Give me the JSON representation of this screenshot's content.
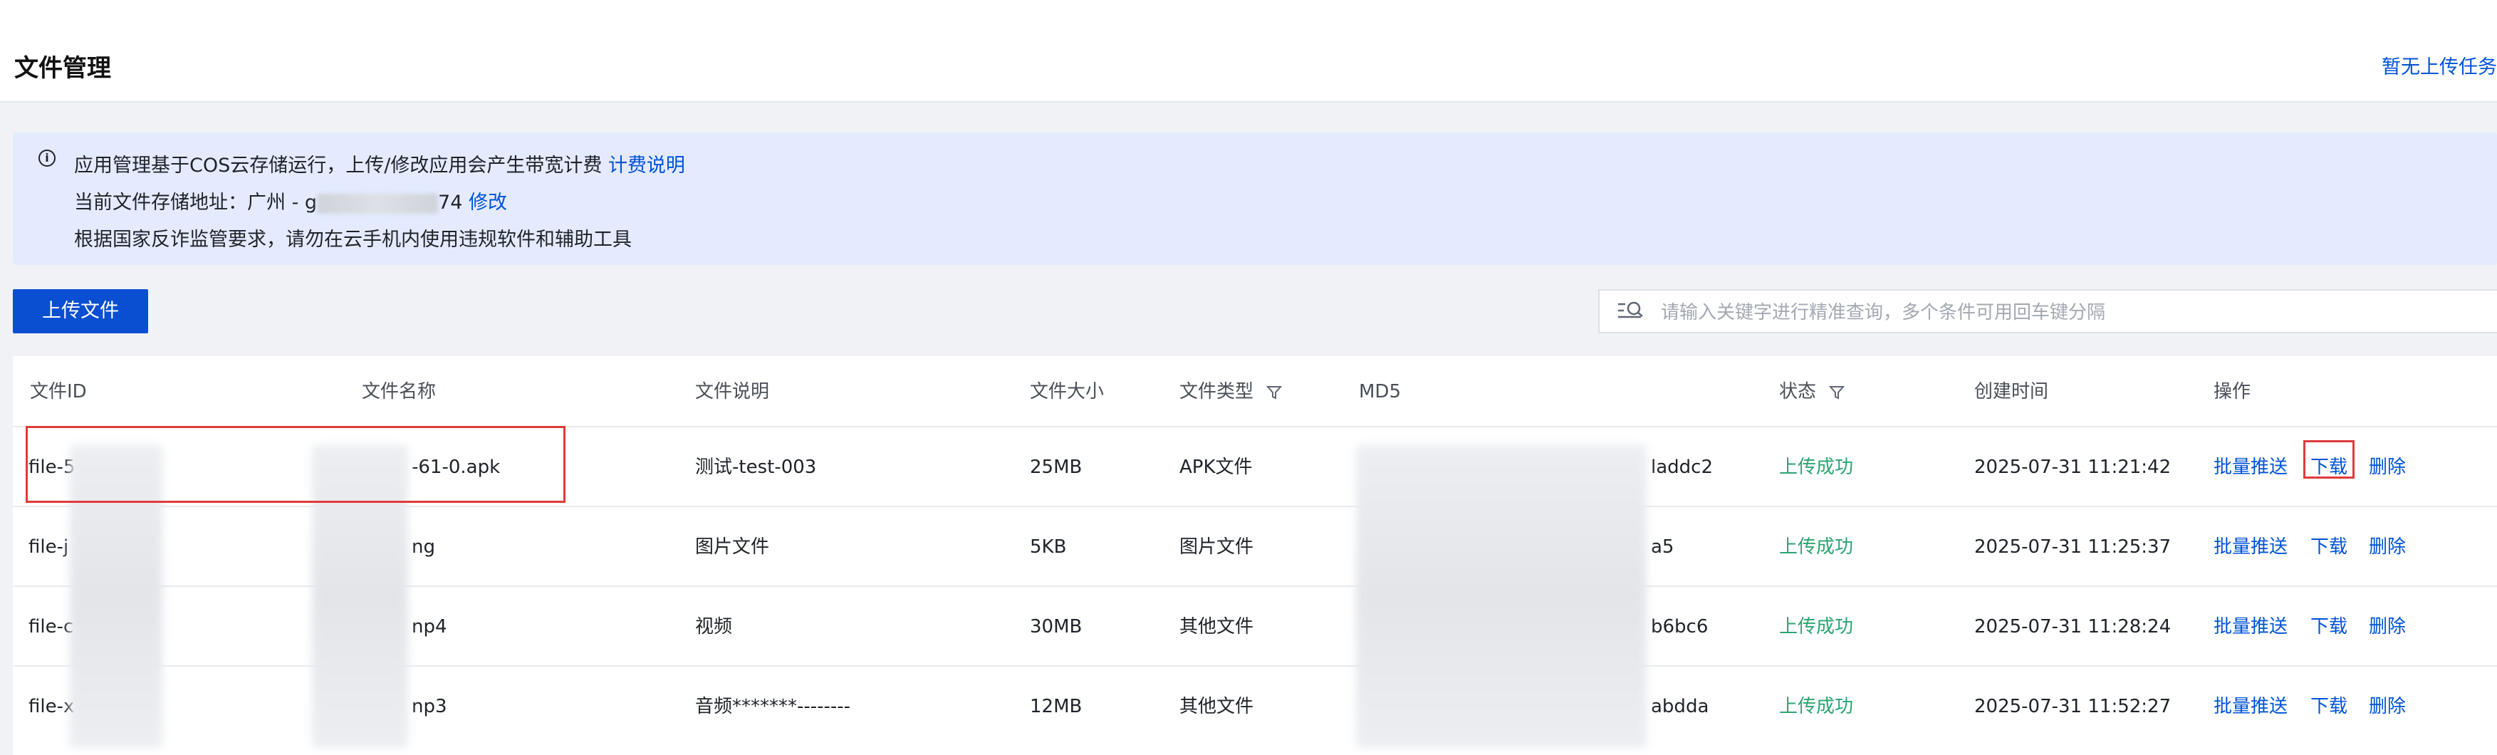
{
  "header": {
    "title": "文件管理",
    "upload_tasks_link": "暂无上传任务"
  },
  "notice": {
    "line1_text": "应用管理基于COS云存储运行，上传/修改应用会产生带宽计费",
    "line1_link": "计费说明",
    "line2_prefix": "当前文件存储地址：广州 - g",
    "line2_suffix": "74",
    "line2_link": "修改",
    "line3_text": "根据国家反诈监管要求，请勿在云手机内使用违规软件和辅助工具"
  },
  "toolbar": {
    "upload_button": "上传文件",
    "search_placeholder": "请输入关键字进行精准查询，多个条件可用回车键分隔"
  },
  "table": {
    "headers": {
      "file_id": "文件ID",
      "file_name": "文件名称",
      "description": "文件说明",
      "size": "文件大小",
      "type": "文件类型",
      "md5": "MD5",
      "status": "状态",
      "created": "创建时间",
      "actions": "操作"
    },
    "actions": {
      "push": "批量推送",
      "download": "下载",
      "delete": "删除"
    },
    "rows": [
      {
        "file_id": "file-5",
        "file_name": "-61-0.apk",
        "description": "测试-test-003",
        "size": "25MB",
        "type": "APK文件",
        "md5": "laddc2",
        "status": "上传成功",
        "created": "2025-07-31 11:21:42"
      },
      {
        "file_id": "file-j",
        "file_name": "ng",
        "description": "图片文件",
        "size": "5KB",
        "type": "图片文件",
        "md5": "a5",
        "status": "上传成功",
        "created": "2025-07-31 11:25:37"
      },
      {
        "file_id": "file-c",
        "file_name": "np4",
        "description": "视频",
        "size": "30MB",
        "type": "其他文件",
        "md5": "b6bc6",
        "status": "上传成功",
        "created": "2025-07-31 11:28:24"
      },
      {
        "file_id": "file-x",
        "file_name": "np3",
        "description": "音频*******--------",
        "size": "12MB",
        "type": "其他文件",
        "md5": "abdda",
        "status": "上传成功",
        "created": "2025-07-31 11:52:27"
      }
    ]
  }
}
